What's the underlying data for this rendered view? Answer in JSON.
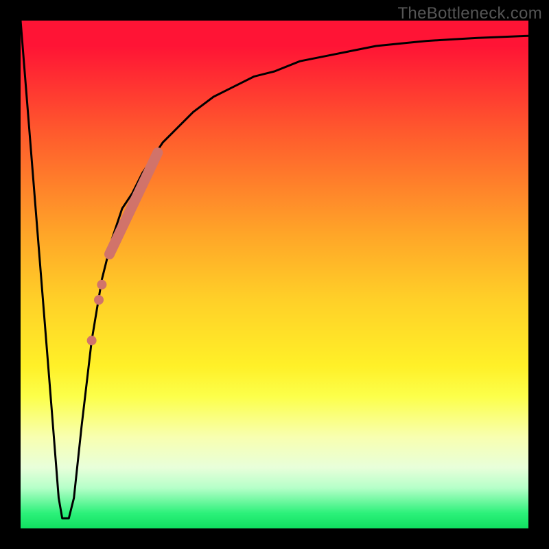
{
  "watermark": "TheBottleneck.com",
  "chart_data": {
    "type": "line",
    "title": "",
    "xlabel": "",
    "ylabel": "",
    "xlim": [
      0,
      100
    ],
    "ylim": [
      0,
      100
    ],
    "series": [
      {
        "name": "bottleneck-curve",
        "x": [
          0,
          2,
          4,
          6,
          7.5,
          8.2,
          9.5,
          10.5,
          12,
          14,
          16,
          18,
          20,
          22,
          24,
          26,
          28,
          30,
          34,
          38,
          42,
          46,
          50,
          55,
          60,
          65,
          70,
          75,
          80,
          85,
          90,
          95,
          100
        ],
        "y": [
          100,
          75,
          50,
          25,
          6,
          2,
          2,
          6,
          20,
          37,
          49,
          57,
          63,
          66,
          70,
          73,
          76,
          78,
          82,
          85,
          87,
          89,
          90,
          92,
          93,
          94,
          95,
          95.5,
          96,
          96.3,
          96.6,
          96.8,
          97
        ]
      }
    ],
    "highlight_band": {
      "name": "highlighted-range",
      "color": "#d1736a",
      "x": [
        17.5,
        27.0
      ],
      "y": [
        54,
        74
      ]
    },
    "highlight_points": [
      {
        "x": 16.0,
        "y": 48
      },
      {
        "x": 15.4,
        "y": 45
      },
      {
        "x": 14.0,
        "y": 37
      }
    ],
    "colors": {
      "curve": "#000000",
      "highlight": "#d1736a",
      "frame": "#000000"
    }
  }
}
